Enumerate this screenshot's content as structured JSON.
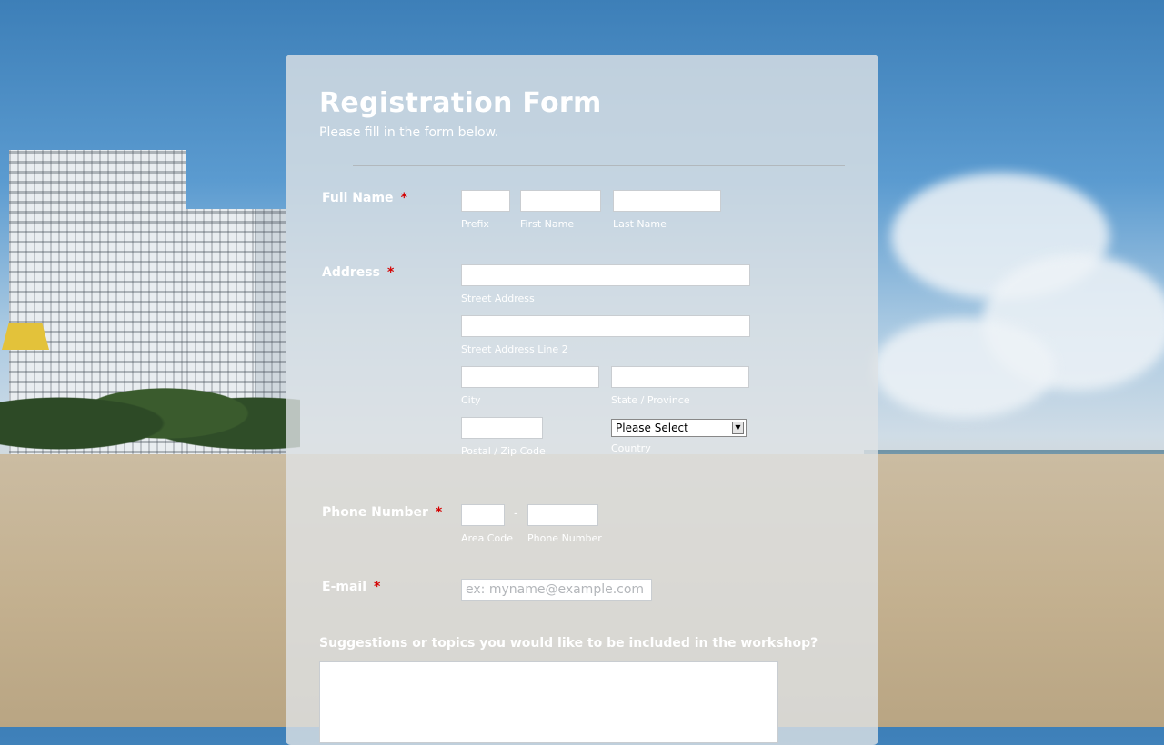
{
  "form": {
    "title": "Registration Form",
    "subtitle": "Please fill in the form below.",
    "required_mark": "*",
    "full_name": {
      "label": "Full Name",
      "prefix_sub": "Prefix",
      "first_sub": "First Name",
      "last_sub": "Last Name",
      "prefix_value": "",
      "first_value": "",
      "last_value": ""
    },
    "address": {
      "label": "Address",
      "street_sub": "Street Address",
      "street2_sub": "Street Address Line 2",
      "city_sub": "City",
      "state_sub": "State / Province",
      "zip_sub": "Postal / Zip Code",
      "country_sub": "Country",
      "country_value": "Please Select"
    },
    "phone": {
      "label": "Phone Number",
      "area_sub": "Area Code",
      "number_sub": "Phone Number",
      "separator": "-"
    },
    "email": {
      "label": "E-mail",
      "placeholder": "ex: myname@example.com"
    },
    "suggestions": {
      "question": "Suggestions or topics you would like to be included in the workshop?"
    }
  },
  "icons": {
    "select_arrow": "chevron-down-icon"
  },
  "colors": {
    "required": "#d40000",
    "label_text": "#ffffff",
    "card_background": "rgba(222,226,229,0.80)"
  }
}
